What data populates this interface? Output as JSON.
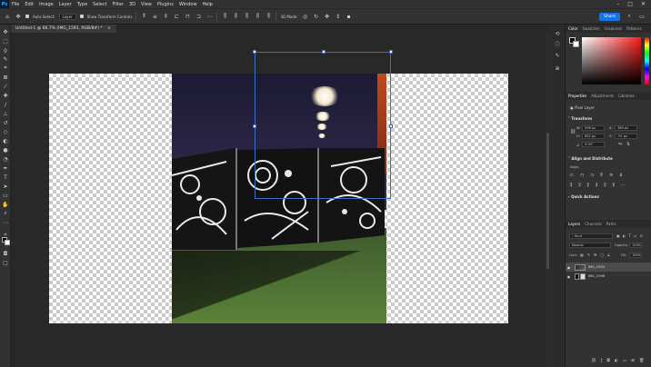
{
  "app": {
    "logo": "Ps"
  },
  "menu": [
    "File",
    "Edit",
    "Image",
    "Layer",
    "Type",
    "Select",
    "Filter",
    "3D",
    "View",
    "Plugins",
    "Window",
    "Help"
  ],
  "window_controls": {
    "minimize": "–",
    "maximize": "□",
    "close": "✕"
  },
  "options": {
    "auto_select_label": "Auto-Select:",
    "auto_select_target": "Layer",
    "show_transform_label": "Show Transform Controls",
    "mode_3d_label": "3D Mode:",
    "share_label": "Share"
  },
  "document_tab": {
    "title": "Untitled-1 @ 66.7% (IMG_1593, RGB/8#) *",
    "close": "×"
  },
  "right_panels": {
    "color_tabs": [
      "Color",
      "Swatches",
      "Gradients",
      "Patterns"
    ],
    "props_tabs": [
      "Properties",
      "Adjustments",
      "Libraries"
    ],
    "pixel_layer_label": "Pixel Layer",
    "transform_header": "Transform",
    "W": "W:",
    "H": "H:",
    "X": "X:",
    "Y": "Y:",
    "w_value": "596 px",
    "x_value": "389 px",
    "h_value": "652 px",
    "y_value": "-91 px",
    "angle_value": "0.00°",
    "align_header": "Align and Distribute",
    "align_sub": "Align:",
    "quick_actions_header": "Quick Actions",
    "layers_tabs": [
      "Layers",
      "Channels",
      "Paths"
    ],
    "kind_label": "Kind",
    "blend_mode": "Normal",
    "opacity_label": "Opacity:",
    "opacity_value": "100%",
    "lock_label": "Lock:",
    "fill_label": "Fill:",
    "fill_value": "100%",
    "layers": [
      {
        "name": "IMG_1593"
      },
      {
        "name": "IMG_1596"
      }
    ]
  },
  "colors": {
    "accent": "#1473e6",
    "selection": "#3e6fc7"
  }
}
